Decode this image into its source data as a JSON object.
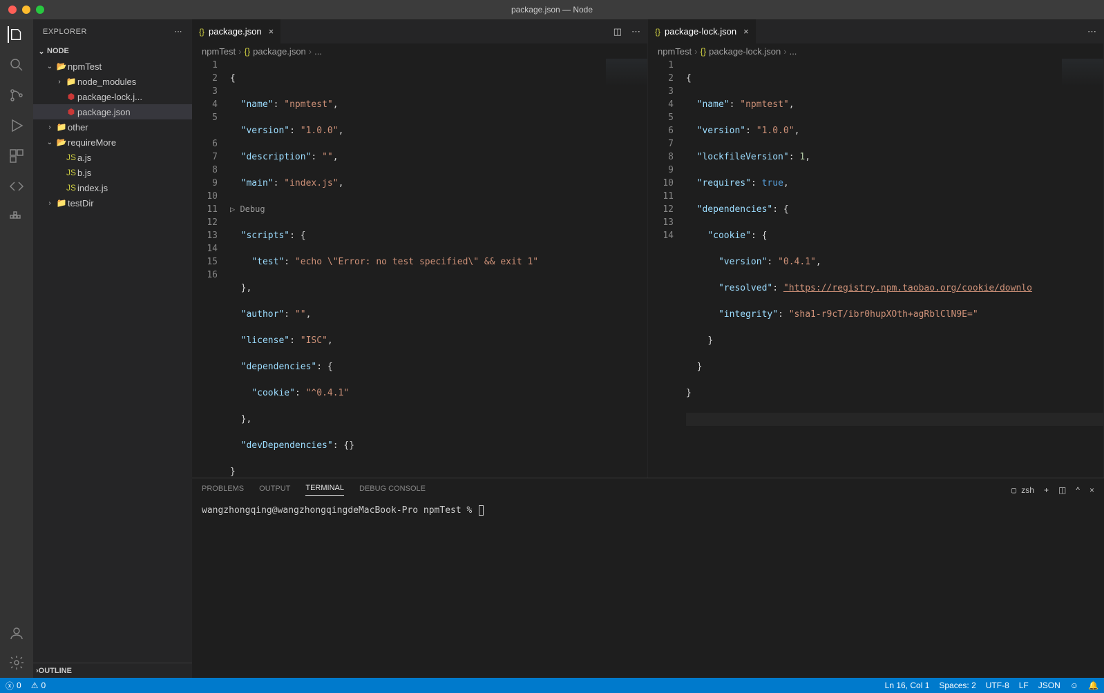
{
  "titleBar": "package.json — Node",
  "explorer": {
    "title": "EXPLORER",
    "rootName": "NODE",
    "outline": "OUTLINE",
    "tree": {
      "npmTest": "npmTest",
      "node_modules": "node_modules",
      "packageLock": "package-lock.j...",
      "packageJson": "package.json",
      "other": "other",
      "requireMore": "requireMore",
      "ajs": "a.js",
      "bjs": "b.js",
      "indexjs": "index.js",
      "testDir": "testDir"
    }
  },
  "tabs": {
    "left": {
      "label": "package.json"
    },
    "right": {
      "label": "package-lock.json"
    }
  },
  "breadcrumbLeft": {
    "p1": "npmTest",
    "p2": "package.json",
    "p3": "..."
  },
  "breadcrumbRight": {
    "p1": "npmTest",
    "p2": "package-lock.json",
    "p3": "..."
  },
  "debugLens": "Debug",
  "codeLeft": {
    "l1": "{",
    "l2a": "\"name\"",
    "l2b": "\"npmtest\"",
    "l3a": "\"version\"",
    "l3b": "\"1.0.0\"",
    "l4a": "\"description\"",
    "l4b": "\"\"",
    "l5a": "\"main\"",
    "l5b": "\"index.js\"",
    "l6a": "\"scripts\"",
    "l7a": "\"test\"",
    "l7b": "\"echo \\\"Error: no test specified\\\" && exit 1\"",
    "l9a": "\"author\"",
    "l9b": "\"\"",
    "l10a": "\"license\"",
    "l10b": "\"ISC\"",
    "l11a": "\"dependencies\"",
    "l12a": "\"cookie\"",
    "l12b": "\"^0.4.1\"",
    "l14a": "\"devDependencies\""
  },
  "codeRight": {
    "l1": "{",
    "l2a": "\"name\"",
    "l2b": "\"npmtest\"",
    "l3a": "\"version\"",
    "l3b": "\"1.0.0\"",
    "l4a": "\"lockfileVersion\"",
    "l4b": "1",
    "l5a": "\"requires\"",
    "l5b": "true",
    "l6a": "\"dependencies\"",
    "l7a": "\"cookie\"",
    "l8a": "\"version\"",
    "l8b": "\"0.4.1\"",
    "l9a": "\"resolved\"",
    "l9b": "\"https://registry.npm.taobao.org/cookie/downlo",
    "l10a": "\"integrity\"",
    "l10b": "\"sha1-r9cT/ibr0hupXOth+agRblClN9E=\""
  },
  "panel": {
    "problems": "PROBLEMS",
    "output": "OUTPUT",
    "terminal": "TERMINAL",
    "debugConsole": "DEBUG CONSOLE",
    "shell": "zsh",
    "promptText": "wangzhongqing@wangzhongqingdeMacBook-Pro npmTest % "
  },
  "status": {
    "errors": "0",
    "warnings": "0",
    "lncol": "Ln 16, Col 1",
    "spaces": "Spaces: 2",
    "encoding": "UTF-8",
    "eol": "LF",
    "lang": "JSON"
  }
}
